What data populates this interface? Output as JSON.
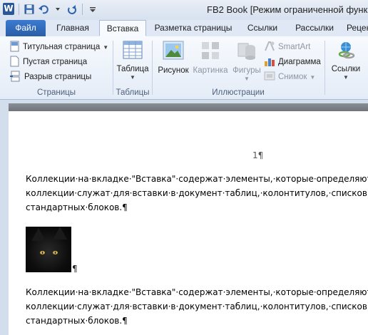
{
  "title_bar": {
    "app_letter": "W",
    "title": "FB2 Book [Режим ограниченной функцио"
  },
  "tabs": [
    {
      "label": "Файл"
    },
    {
      "label": "Главная"
    },
    {
      "label": "Вставка"
    },
    {
      "label": "Разметка страницы"
    },
    {
      "label": "Ссылки"
    },
    {
      "label": "Рассылки"
    },
    {
      "label": "Рецен"
    }
  ],
  "ribbon": {
    "pages": {
      "label": "Страницы",
      "cover_page": "Титульная страница",
      "blank_page": "Пустая страница",
      "page_break": "Разрыв страницы"
    },
    "tables": {
      "label": "Таблицы",
      "table": "Таблица"
    },
    "illustrations": {
      "label": "Иллюстрации",
      "picture": "Рисунок",
      "clipart": "Картинка",
      "shapes": "Фигуры",
      "smartart": "SmartArt",
      "chart": "Диаграмма",
      "screenshot": "Снимок"
    },
    "links": {
      "links": "Ссылки"
    }
  },
  "document": {
    "page_number": "1¶",
    "paragraph1": {
      "line1": "Коллекции·на·вкладке·\"Вставка\"·содержат·элементы,·которые·определяют·о",
      "line2": "коллекции·служат·для·вставки·в·документ·таблиц,·колонтитулов,·списков,·ти",
      "line3": "стандартных·блоков.¶"
    },
    "image_pilcrow": "¶",
    "paragraph2": {
      "line1": "Коллекции·на·вкладке·\"Вставка\"·содержат·элементы,·которые·определяют·о",
      "line2": "коллекции·служат·для·вставки·в·документ·таблиц,·колонтитулов,·списков,·ти",
      "line3": "стандартных·блоков.¶"
    }
  },
  "colors": {
    "file_tab": "#2a5ea8",
    "ribbon_bg": "#e4ecf7",
    "ruler": "#7a7f86"
  }
}
